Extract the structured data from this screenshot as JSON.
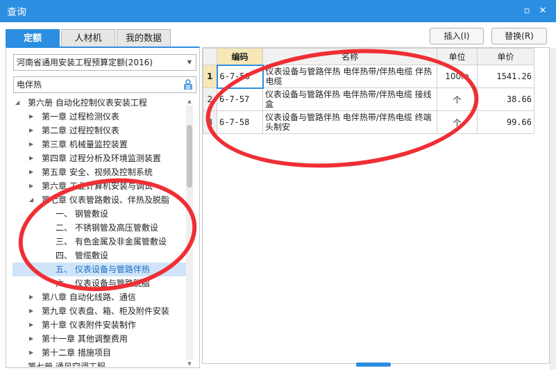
{
  "window": {
    "title": "查询",
    "restore_icon": "restore-icon",
    "close_icon": "close-icon"
  },
  "tabs": [
    {
      "label": "定额",
      "active": true
    },
    {
      "label": "人材机",
      "active": false
    },
    {
      "label": "我的数据",
      "active": false
    }
  ],
  "actions": {
    "insert_label": "插入(I)",
    "replace_label": "替换(R)"
  },
  "left": {
    "quota_select": {
      "value": "河南省通用安装工程预算定额(2016)"
    },
    "search": {
      "value": "电伴热",
      "icon": "search-filter-icon"
    },
    "tree": [
      {
        "label": "第六册 自动化控制仪表安装工程",
        "level": 0,
        "expanded": true
      },
      {
        "label": "第一章 过程检测仪表",
        "level": 1,
        "expanded": false
      },
      {
        "label": "第二章 过程控制仪表",
        "level": 1,
        "expanded": false
      },
      {
        "label": "第三章 机械量监控装置",
        "level": 1,
        "expanded": false
      },
      {
        "label": "第四章 过程分析及环境监测装置",
        "level": 1,
        "expanded": false
      },
      {
        "label": "第五章 安全、视频及控制系统",
        "level": 1,
        "expanded": false
      },
      {
        "label": "第六章 工业计算机安装与调试",
        "level": 1,
        "expanded": false
      },
      {
        "label": "第七章 仪表管路敷设、伴热及脱脂",
        "level": 1,
        "expanded": true
      },
      {
        "label": "一、 钢管敷设",
        "level": 2
      },
      {
        "label": "二、 不锈钢管及高压管敷设",
        "level": 2
      },
      {
        "label": "三、 有色金属及非金属管敷设",
        "level": 2
      },
      {
        "label": "四、 管缆敷设",
        "level": 2
      },
      {
        "label": "五、 仪表设备与管路伴热",
        "level": 2,
        "selected": true
      },
      {
        "label": "六、 仪表设备与管路脱脂",
        "level": 2
      },
      {
        "label": "第八章 自动化线路、通信",
        "level": 1,
        "expanded": false
      },
      {
        "label": "第九章 仪表盘、箱、柜及附件安装",
        "level": 1,
        "expanded": false
      },
      {
        "label": "第十章 仪表附件安装制作",
        "level": 1,
        "expanded": false
      },
      {
        "label": "第十一章 其他调整费用",
        "level": 1,
        "expanded": false
      },
      {
        "label": "第十二章 措施项目",
        "level": 1,
        "expanded": false
      },
      {
        "label": "第七册 通风空调工程",
        "level": 0,
        "expanded": false
      }
    ]
  },
  "grid": {
    "headers": {
      "code": "编码",
      "name": "名称",
      "unit": "单位",
      "price": "单价"
    },
    "rows": [
      {
        "index": "1",
        "code": "6-7-56",
        "name": "仪表设备与管路伴热 电伴热带/伴热电缆 伴热电缆",
        "unit": "100m",
        "price": "1541.26"
      },
      {
        "index": "2",
        "code": "6-7-57",
        "name": "仪表设备与管路伴热 电伴热带/伴热电缆 接线盒",
        "unit": "个",
        "price": "38.66"
      },
      {
        "index": "3",
        "code": "6-7-58",
        "name": "仪表设备与管路伴热 电伴热带/伴热电缆 终端头制安",
        "unit": "个",
        "price": "99.66"
      }
    ]
  },
  "colors": {
    "accent": "#2c8ee0",
    "highlight_header": "#f7e7b7",
    "annotation_circle": "#ef2f35",
    "selected_row": "#cfe4f8"
  }
}
